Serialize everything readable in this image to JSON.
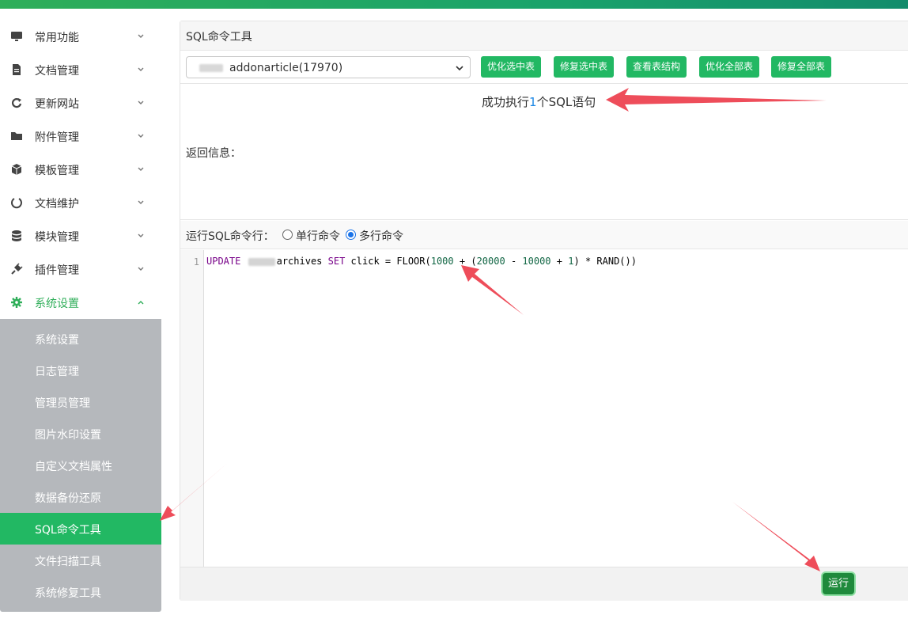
{
  "sidebar": {
    "items": [
      {
        "label": "常用功能",
        "icon": "monitor-icon"
      },
      {
        "label": "文档管理",
        "icon": "document-icon"
      },
      {
        "label": "更新网站",
        "icon": "refresh-icon"
      },
      {
        "label": "附件管理",
        "icon": "folder-icon"
      },
      {
        "label": "模板管理",
        "icon": "cube-icon"
      },
      {
        "label": "文档维护",
        "icon": "circle-icon"
      },
      {
        "label": "模块管理",
        "icon": "database-icon"
      },
      {
        "label": "插件管理",
        "icon": "plug-icon"
      },
      {
        "label": "系统设置",
        "icon": "gear-icon",
        "expanded": true
      }
    ],
    "submenu": [
      {
        "label": "系统设置"
      },
      {
        "label": "日志管理"
      },
      {
        "label": "管理员管理"
      },
      {
        "label": "图片水印设置"
      },
      {
        "label": "自定义文档属性"
      },
      {
        "label": "数据备份还原"
      },
      {
        "label": "SQL命令工具",
        "current": true
      },
      {
        "label": "文件扫描工具"
      },
      {
        "label": "系统修复工具"
      }
    ]
  },
  "panel": {
    "title": "SQL命令工具",
    "table_select": {
      "value": "addonarticle(17970)"
    },
    "buttons": {
      "optimize_selected": "优化选中表",
      "repair_selected": "修复选中表",
      "view_structure": "查看表结构",
      "optimize_all": "优化全部表",
      "repair_all": "修复全部表"
    },
    "result": {
      "msg_prefix": "成功执行",
      "msg_count": "1",
      "msg_suffix": "个SQL语句",
      "return_label": "返回信息："
    },
    "mode": {
      "label": "运行SQL命令行：",
      "single": "单行命令",
      "multi": "多行命令",
      "selected": "multi"
    },
    "editor": {
      "line_number": "1",
      "tokens": {
        "update": "UPDATE",
        "table": "archives",
        "set": "SET",
        "col": "click",
        "eq": "=",
        "floor": "FLOOR(",
        "n1000": "1000",
        "plus": "+",
        "open": "(",
        "n20000": "20000",
        "minus": "-",
        "n10000": "10000",
        "plus2": "+",
        "n1": "1",
        "close": ")",
        "mul": "*",
        "rand": "RAND())"
      }
    },
    "run_button": "运行"
  },
  "colors": {
    "accent": "#22b863",
    "run": "#1f8a3c",
    "annotation": "#ee4d5a"
  }
}
